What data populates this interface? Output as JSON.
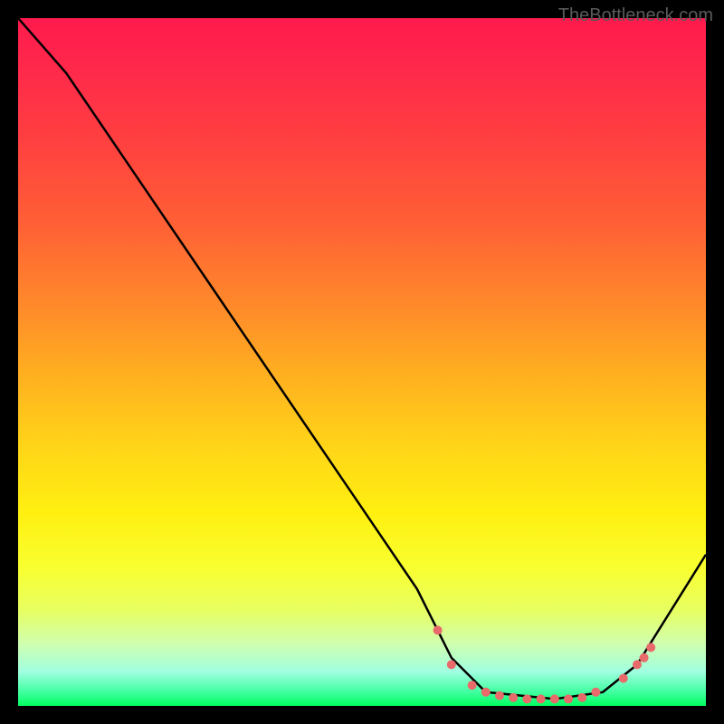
{
  "watermark": "TheBottleneck.com",
  "chart_data": {
    "type": "line",
    "title": "",
    "xlabel": "",
    "ylabel": "",
    "x_range": [
      0,
      100
    ],
    "y_range": [
      0,
      100
    ],
    "series": [
      {
        "name": "curve",
        "points": [
          {
            "x": 0,
            "y": 100
          },
          {
            "x": 7,
            "y": 92
          },
          {
            "x": 58,
            "y": 17
          },
          {
            "x": 63,
            "y": 7
          },
          {
            "x": 68,
            "y": 2
          },
          {
            "x": 78,
            "y": 1
          },
          {
            "x": 85,
            "y": 2
          },
          {
            "x": 90,
            "y": 6
          },
          {
            "x": 100,
            "y": 22
          }
        ]
      }
    ],
    "markers": [
      {
        "x": 61,
        "y": 11
      },
      {
        "x": 63,
        "y": 6
      },
      {
        "x": 66,
        "y": 3
      },
      {
        "x": 68,
        "y": 2
      },
      {
        "x": 70,
        "y": 1.5
      },
      {
        "x": 72,
        "y": 1.2
      },
      {
        "x": 74,
        "y": 1
      },
      {
        "x": 76,
        "y": 1
      },
      {
        "x": 78,
        "y": 1
      },
      {
        "x": 80,
        "y": 1
      },
      {
        "x": 82,
        "y": 1.2
      },
      {
        "x": 84,
        "y": 2
      },
      {
        "x": 88,
        "y": 4
      },
      {
        "x": 90,
        "y": 6
      },
      {
        "x": 91,
        "y": 7
      },
      {
        "x": 92,
        "y": 8.5
      }
    ],
    "marker_color": "#e86a6a",
    "line_color": "#000000"
  }
}
